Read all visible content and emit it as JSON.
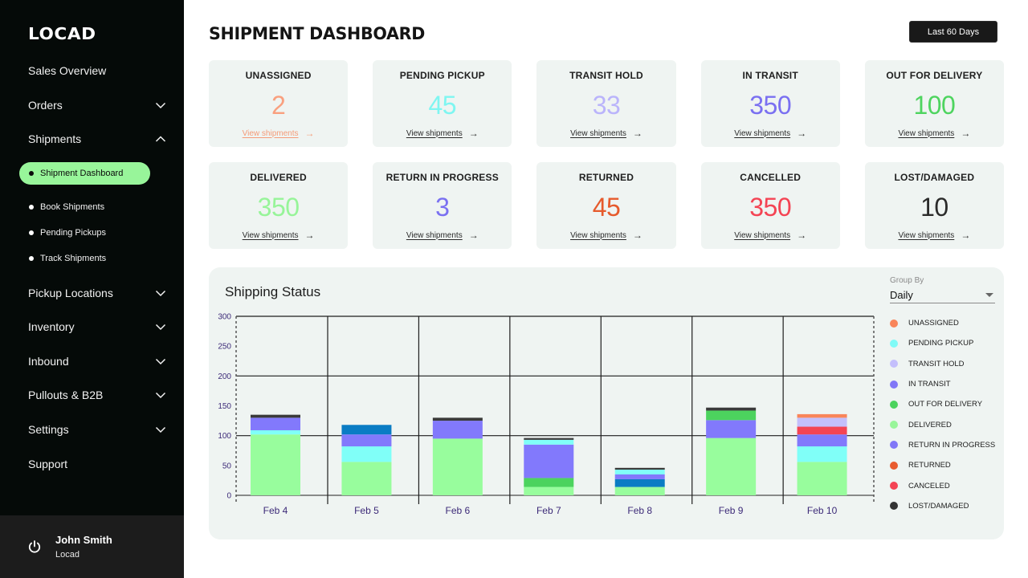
{
  "sidebar": {
    "logo": "LOCAD",
    "items": [
      {
        "label": "Sales Overview",
        "chevron": "none"
      },
      {
        "label": "Orders",
        "chevron": "chevron-down"
      },
      {
        "label": "Shipments",
        "chevron": "chevron-up"
      },
      {
        "label": "Pickup Locations",
        "chevron": "chevron-down"
      },
      {
        "label": "Inventory",
        "chevron": "chevron-down"
      },
      {
        "label": "Inbound",
        "chevron": "chevron-down"
      },
      {
        "label": "Pullouts & B2B",
        "chevron": "chevron-down"
      },
      {
        "label": "Settings",
        "chevron": "chevron-down"
      },
      {
        "label": "Support",
        "chevron": "none"
      }
    ],
    "sub_items": [
      {
        "label": "Shipment Dashboard",
        "active": true
      },
      {
        "label": "Book Shipments",
        "active": false
      },
      {
        "label": "Pending Pickups",
        "active": false
      },
      {
        "label": "Track Shipments",
        "active": false
      }
    ],
    "user": {
      "name": "John Smith",
      "org": "Locad",
      "icon": "power-icon"
    }
  },
  "header": {
    "title": "SHIPMENT DASHBOARD",
    "range_button": "Last 60 Days"
  },
  "cards": [
    {
      "label": "UNASSIGNED",
      "value": "2",
      "color": "#f9a07f",
      "link": "View shipments",
      "link_color": "#f59b78"
    },
    {
      "label": "PENDING PICKUP",
      "value": "45",
      "color": "#7ff6f1",
      "link": "View shipments"
    },
    {
      "label": "TRANSIT HOLD",
      "value": "33",
      "color": "#bab4fb",
      "link": "View shipments"
    },
    {
      "label": "IN TRANSIT",
      "value": "350",
      "color": "#7a70f1",
      "link": "View shipments"
    },
    {
      "label": "OUT FOR DELIVERY",
      "value": "100",
      "color": "#4ed45f",
      "link": "View shipments"
    },
    {
      "label": "DELIVERED",
      "value": "350",
      "color": "#97f499",
      "link": "View shipments"
    },
    {
      "label": "RETURN IN PROGRESS",
      "value": "3",
      "color": "#7a70f1",
      "link": "View shipments"
    },
    {
      "label": "RETURNED",
      "value": "45",
      "color": "#e65a2c",
      "link": "View shipments"
    },
    {
      "label": "CANCELLED",
      "value": "350",
      "color": "#f44454",
      "link": "View shipments"
    },
    {
      "label": "LOST/DAMAGED",
      "value": "10",
      "color": "#2b2b2b",
      "link": "View shipments"
    }
  ],
  "chart_panel": {
    "group_by_label": "Group By",
    "group_by_value": "Daily"
  },
  "chart_data": {
    "type": "bar",
    "stacked": true,
    "title": "Shipping Status",
    "xlabel": "",
    "ylabel": "",
    "ylim": [
      0,
      300
    ],
    "yticks": [
      0,
      50,
      100,
      150,
      200,
      250,
      300
    ],
    "gridlines_y": [
      0,
      100,
      200,
      300
    ],
    "grid": true,
    "legend_position": "right",
    "categories": [
      "Feb 4",
      "Feb 5",
      "Feb 6",
      "Feb 7",
      "Feb 8",
      "Feb 9",
      "Feb 10"
    ],
    "legend": [
      {
        "name": "UNASSIGNED",
        "color": "#f9855a"
      },
      {
        "name": "PENDING PICKUP",
        "color": "#80fbf7"
      },
      {
        "name": "TRANSIT HOLD",
        "color": "#c4bffc"
      },
      {
        "name": "IN TRANSIT",
        "color": "#8177f7"
      },
      {
        "name": "OUT FOR DELIVERY",
        "color": "#4cd35e"
      },
      {
        "name": "DELIVERED",
        "color": "#98f59a"
      },
      {
        "name": "RETURN IN PROGRESS",
        "color": "#8177f7"
      },
      {
        "name": "RETURNED",
        "color": "#e85b2f"
      },
      {
        "name": "CANCELED",
        "color": "#f44454"
      },
      {
        "name": "LOST/DAMAGED",
        "color": "#333333"
      }
    ],
    "stacks": [
      {
        "category": "Feb 4",
        "segments": [
          {
            "series": "DELIVERED",
            "value": 102,
            "color": "#98fd9d"
          },
          {
            "series": "PENDING PICKUP",
            "value": 7,
            "color": "#80fff8"
          },
          {
            "series": "IN TRANSIT",
            "value": 21,
            "color": "#8279fc"
          },
          {
            "series": "LOST/DAMAGED",
            "value": 5,
            "color": "#3a3a3a"
          }
        ]
      },
      {
        "category": "Feb 5",
        "segments": [
          {
            "series": "DELIVERED",
            "value": 56,
            "color": "#98fd9d"
          },
          {
            "series": "PENDING PICKUP",
            "value": 26,
            "color": "#80fff8"
          },
          {
            "series": "IN TRANSIT",
            "value": 20,
            "color": "#8279fc"
          },
          {
            "series": null,
            "value": 16,
            "color": "#0a7cc4"
          }
        ]
      },
      {
        "category": "Feb 6",
        "segments": [
          {
            "series": "DELIVERED",
            "value": 95,
            "color": "#98fd9d"
          },
          {
            "series": "IN TRANSIT",
            "value": 30,
            "color": "#8279fc"
          },
          {
            "series": "LOST/DAMAGED",
            "value": 5,
            "color": "#3a3a3a"
          }
        ]
      },
      {
        "category": "Feb 7",
        "segments": [
          {
            "series": "DELIVERED",
            "value": 14,
            "color": "#98fd9d"
          },
          {
            "series": "OUT FOR DELIVERY",
            "value": 15,
            "color": "#4cd35e"
          },
          {
            "series": "IN TRANSIT",
            "value": 56,
            "color": "#8279fc"
          },
          {
            "series": "PENDING PICKUP",
            "value": 8,
            "color": "#80fff8"
          },
          {
            "series": "LOST/DAMAGED",
            "value": 3,
            "color": "#3a3a3a"
          }
        ]
      },
      {
        "category": "Feb 8",
        "segments": [
          {
            "series": "DELIVERED",
            "value": 14,
            "color": "#98fd9d"
          },
          {
            "series": null,
            "value": 13,
            "color": "#0a7cc4"
          },
          {
            "series": "IN TRANSIT",
            "value": 8,
            "color": "#8279fc"
          },
          {
            "series": "PENDING PICKUP",
            "value": 8,
            "color": "#80fff8"
          },
          {
            "series": "LOST/DAMAGED",
            "value": 3,
            "color": "#3a3a3a"
          }
        ]
      },
      {
        "category": "Feb 9",
        "segments": [
          {
            "series": "DELIVERED",
            "value": 96,
            "color": "#98fd9d"
          },
          {
            "series": "IN TRANSIT",
            "value": 30,
            "color": "#8279fc"
          },
          {
            "series": "OUT FOR DELIVERY",
            "value": 16,
            "color": "#4cd35e"
          },
          {
            "series": "LOST/DAMAGED",
            "value": 5,
            "color": "#3a3a3a"
          }
        ]
      },
      {
        "category": "Feb 10",
        "segments": [
          {
            "series": "DELIVERED",
            "value": 56,
            "color": "#98fd9d"
          },
          {
            "series": "PENDING PICKUP",
            "value": 26,
            "color": "#80fff8"
          },
          {
            "series": "IN TRANSIT",
            "value": 20,
            "color": "#8279fc"
          },
          {
            "series": "CANCELED",
            "value": 13,
            "color": "#f44454"
          },
          {
            "series": "TRANSIT HOLD",
            "value": 15,
            "color": "#c4bffc"
          },
          {
            "series": "UNASSIGNED",
            "value": 6,
            "color": "#f9855a"
          }
        ]
      }
    ]
  }
}
